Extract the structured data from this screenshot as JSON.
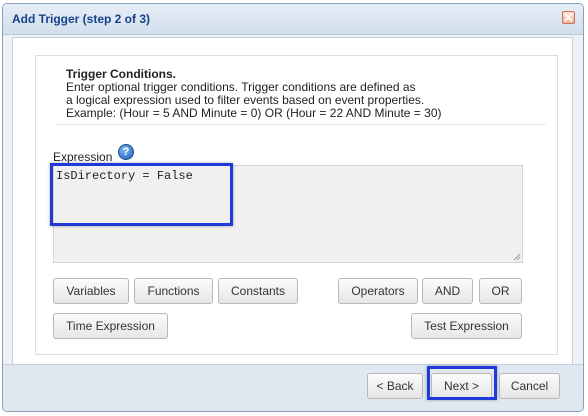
{
  "dialog": {
    "title": "Add Trigger (step 2 of 3)"
  },
  "intro": {
    "heading": "Trigger Conditions.",
    "lines": [
      "Enter optional trigger conditions. Trigger conditions are defined as",
      "a logical expression used to filter events based on event properties.",
      "Example: (Hour = 5 AND Minute = 0) OR (Hour = 22 AND Minute = 30)"
    ]
  },
  "expression": {
    "label": "Expression",
    "help_icon": "question-icon",
    "value": "IsDirectory = False"
  },
  "buttons": {
    "variables": "Variables",
    "functions": "Functions",
    "constants": "Constants",
    "operators": "Operators",
    "and": "AND",
    "or": "OR",
    "time_expression": "Time Expression",
    "test_expression": "Test Expression"
  },
  "footer": {
    "back": "< Back",
    "next": "Next >",
    "cancel": "Cancel"
  },
  "colors": {
    "title_text": "#15428b",
    "highlight": "#1f3ad8"
  }
}
